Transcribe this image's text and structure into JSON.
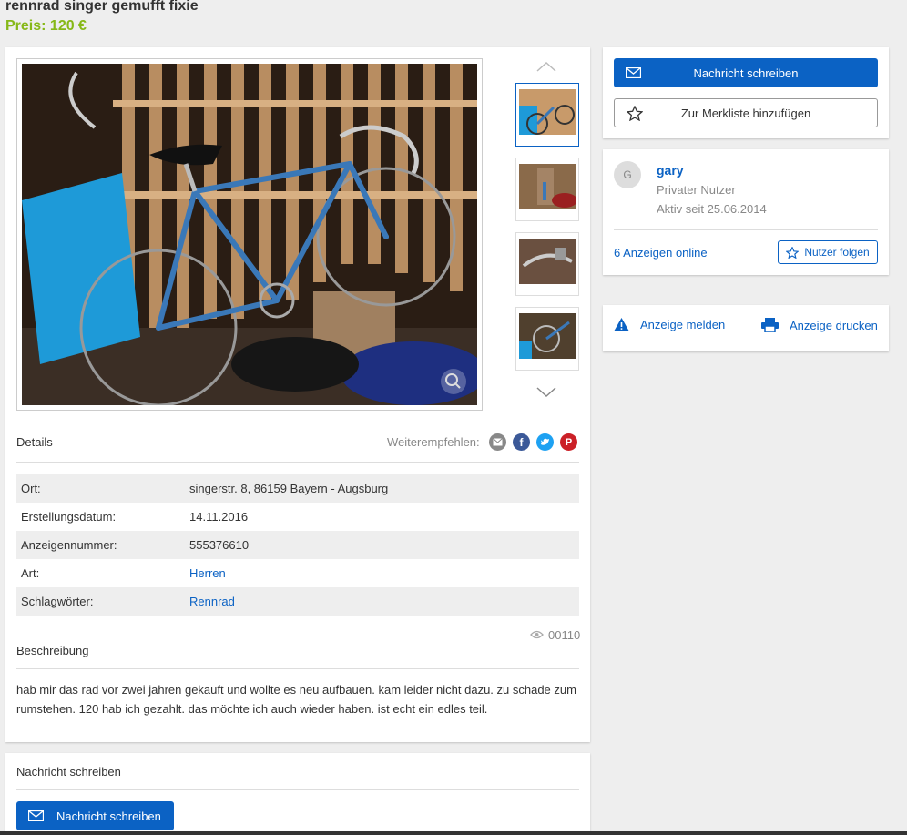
{
  "ad": {
    "title": "rennrad singer gemufft fixie",
    "price": "Preis: 120 €"
  },
  "gallery": {
    "thumb_count": 4
  },
  "details": {
    "label": "Details",
    "share_label": "Weiterempfehlen:",
    "share_icons": [
      "email-icon",
      "facebook-icon",
      "twitter-icon",
      "pinterest-icon"
    ],
    "rows": [
      {
        "key": "Ort:",
        "value": "singerstr. 8, 86159 Bayern - Augsburg"
      },
      {
        "key": "Erstellungsdatum:",
        "value": "14.11.2016"
      },
      {
        "key": "Anzeigennummer:",
        "value": "555376610"
      },
      {
        "key": "Art:",
        "value": "Herren"
      },
      {
        "key": "Schlagwörter:",
        "value": "Rennrad"
      }
    ]
  },
  "description": {
    "label": "Beschreibung",
    "views": "00110",
    "text": "hab mir das rad vor zwei jahren gekauft und wollte es neu aufbauen. kam leider nicht dazu. zu schade zum rumstehen. 120 hab ich gezahlt. das möchte ich auch wieder haben. ist echt ein edles teil."
  },
  "contact": {
    "label": "Nachricht schreiben",
    "button": "Nachricht schreiben"
  },
  "actions": {
    "message_button": "Nachricht schreiben",
    "watchlist_button": "Zur Merkliste hinzufügen"
  },
  "seller": {
    "avatar_letter": "G",
    "name": "gary",
    "type": "Privater Nutzer",
    "active_since": "Aktiv seit 25.06.2014",
    "ads_online": "6 Anzeigen online",
    "follow_button": "Nutzer folgen"
  },
  "misc": {
    "report": "Anzeige melden",
    "print": "Anzeige drucken"
  },
  "colors": {
    "accent": "#0b62c4",
    "price": "#86b817"
  }
}
